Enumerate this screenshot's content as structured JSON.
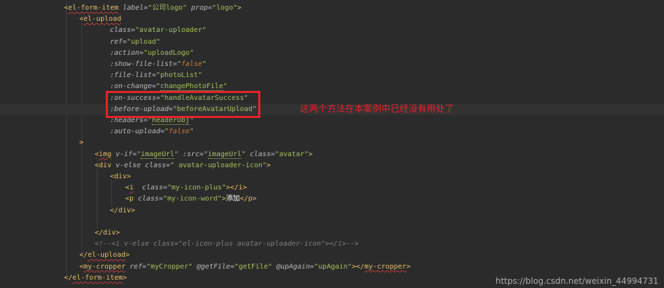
{
  "editor": {
    "lines": [
      {
        "id": "l0",
        "tokens": [
          {
            "c": "br",
            "t": "<"
          },
          {
            "c": "tag ut",
            "t": "el-form-item"
          },
          {
            "c": "eq",
            "t": " "
          },
          {
            "c": "attr",
            "t": "label"
          },
          {
            "c": "eq",
            "t": "="
          },
          {
            "c": "val",
            "t": "\"公司logo\""
          },
          {
            "c": "eq",
            "t": " "
          },
          {
            "c": "attr",
            "t": "prop"
          },
          {
            "c": "eq",
            "t": "="
          },
          {
            "c": "val",
            "t": "\"logo\""
          },
          {
            "c": "br",
            "t": ">"
          }
        ]
      },
      {
        "id": "l1",
        "tokens": [
          {
            "c": "br",
            "t": "<"
          },
          {
            "c": "tag ut",
            "t": "el-upload"
          }
        ]
      },
      {
        "id": "l2",
        "tokens": [
          {
            "c": "attr",
            "t": "class"
          },
          {
            "c": "eq",
            "t": "="
          },
          {
            "c": "val",
            "t": "\"avatar-uploader\""
          }
        ]
      },
      {
        "id": "l3",
        "tokens": [
          {
            "c": "attr",
            "t": "ref"
          },
          {
            "c": "eq",
            "t": "="
          },
          {
            "c": "val",
            "t": "\"upload\""
          }
        ]
      },
      {
        "id": "l4",
        "tokens": [
          {
            "c": "attr",
            "t": ":action"
          },
          {
            "c": "eq",
            "t": "="
          },
          {
            "c": "val",
            "t": "\"uploadLogo\""
          }
        ]
      },
      {
        "id": "l5",
        "tokens": [
          {
            "c": "attr",
            "t": ":show-file-list"
          },
          {
            "c": "eq",
            "t": "="
          },
          {
            "c": "val",
            "t": "\""
          },
          {
            "c": "kw",
            "t": "false"
          },
          {
            "c": "val",
            "t": "\""
          }
        ]
      },
      {
        "id": "l6",
        "tokens": [
          {
            "c": "attr",
            "t": ":file-list"
          },
          {
            "c": "eq",
            "t": "="
          },
          {
            "c": "val",
            "t": "\"photoList\""
          }
        ]
      },
      {
        "id": "l7",
        "tokens": [
          {
            "c": "attr",
            "t": ":on-change"
          },
          {
            "c": "eq",
            "t": "="
          },
          {
            "c": "val",
            "t": "\""
          },
          {
            "c": "val u",
            "t": "changePhotoFile"
          },
          {
            "c": "val",
            "t": "\""
          }
        ]
      },
      {
        "id": "l8",
        "tokens": [
          {
            "c": "attr",
            "t": ":on-success"
          },
          {
            "c": "eq",
            "t": "="
          },
          {
            "c": "val",
            "t": "\"handleAvatarSuccess\""
          }
        ]
      },
      {
        "id": "l9",
        "tokens": [
          {
            "c": "attr",
            "t": ":before-upload"
          },
          {
            "c": "eq",
            "t": "="
          },
          {
            "c": "val",
            "t": "\"beforeAvatarUpload\""
          }
        ]
      },
      {
        "id": "l10",
        "tokens": [
          {
            "c": "attr",
            "t": ":headers"
          },
          {
            "c": "eq",
            "t": "="
          },
          {
            "c": "val",
            "t": "\""
          },
          {
            "c": "val u",
            "t": "headerObj"
          },
          {
            "c": "val",
            "t": "\""
          }
        ]
      },
      {
        "id": "l11",
        "tokens": [
          {
            "c": "attr",
            "t": ":auto-upload"
          },
          {
            "c": "eq",
            "t": "="
          },
          {
            "c": "val",
            "t": "\""
          },
          {
            "c": "kw",
            "t": "false"
          },
          {
            "c": "val",
            "t": "\""
          }
        ]
      },
      {
        "id": "l12",
        "tokens": [
          {
            "c": "br",
            "t": ">"
          }
        ]
      },
      {
        "id": "l13",
        "tokens": [
          {
            "c": "br",
            "t": "<"
          },
          {
            "c": "tag ut",
            "t": "img"
          },
          {
            "c": "eq",
            "t": " "
          },
          {
            "c": "attr",
            "t": "v-if"
          },
          {
            "c": "eq",
            "t": "="
          },
          {
            "c": "val",
            "t": "\""
          },
          {
            "c": "val u",
            "t": "imageUrl"
          },
          {
            "c": "val",
            "t": "\""
          },
          {
            "c": "eq",
            "t": " "
          },
          {
            "c": "attr",
            "t": ":src"
          },
          {
            "c": "eq",
            "t": "="
          },
          {
            "c": "val",
            "t": "\""
          },
          {
            "c": "val u",
            "t": "imageUrl"
          },
          {
            "c": "val",
            "t": "\""
          },
          {
            "c": "eq",
            "t": " "
          },
          {
            "c": "attr",
            "t": "class"
          },
          {
            "c": "eq",
            "t": "="
          },
          {
            "c": "val",
            "t": "\"avatar\""
          },
          {
            "c": "br",
            "t": ">"
          }
        ]
      },
      {
        "id": "l14",
        "tokens": [
          {
            "c": "br",
            "t": "<"
          },
          {
            "c": "tag",
            "t": "div"
          },
          {
            "c": "eq",
            "t": " "
          },
          {
            "c": "attr",
            "t": "v-else"
          },
          {
            "c": "eq",
            "t": " "
          },
          {
            "c": "attr",
            "t": "class"
          },
          {
            "c": "eq",
            "t": "="
          },
          {
            "c": "val",
            "t": "\" avatar-uploader-icon\""
          },
          {
            "c": "br",
            "t": ">"
          }
        ]
      },
      {
        "id": "l15",
        "tokens": [
          {
            "c": "br",
            "t": "<"
          },
          {
            "c": "tag",
            "t": "div"
          },
          {
            "c": "br",
            "t": ">"
          }
        ]
      },
      {
        "id": "l16",
        "tokens": [
          {
            "c": "br",
            "t": "<"
          },
          {
            "c": "tag ut",
            "t": "i"
          },
          {
            "c": "eq",
            "t": "  "
          },
          {
            "c": "attr",
            "t": "class"
          },
          {
            "c": "eq",
            "t": "="
          },
          {
            "c": "val",
            "t": "\"my-icon-plus\""
          },
          {
            "c": "br",
            "t": "></"
          },
          {
            "c": "tag",
            "t": "i"
          },
          {
            "c": "br",
            "t": ">"
          }
        ]
      },
      {
        "id": "l17",
        "tokens": [
          {
            "c": "br",
            "t": "<"
          },
          {
            "c": "tag",
            "t": "p"
          },
          {
            "c": "eq",
            "t": " "
          },
          {
            "c": "attr",
            "t": "class"
          },
          {
            "c": "eq",
            "t": "="
          },
          {
            "c": "val",
            "t": "\"my-icon-word\""
          },
          {
            "c": "br",
            "t": ">"
          },
          {
            "c": "txt",
            "t": "添加"
          },
          {
            "c": "br",
            "t": "</"
          },
          {
            "c": "tag",
            "t": "p"
          },
          {
            "c": "br",
            "t": ">"
          }
        ]
      },
      {
        "id": "l18",
        "tokens": [
          {
            "c": "br",
            "t": "</"
          },
          {
            "c": "tag",
            "t": "div"
          },
          {
            "c": "br",
            "t": ">"
          }
        ]
      },
      {
        "id": "l19",
        "tokens": []
      },
      {
        "id": "l20",
        "tokens": [
          {
            "c": "br",
            "t": "</"
          },
          {
            "c": "tag",
            "t": "div"
          },
          {
            "c": "br",
            "t": ">"
          }
        ]
      },
      {
        "id": "l21",
        "tokens": [
          {
            "c": "cmt2",
            "t": "<!--<i v-else class=\"el-icon-plus avatar-uploader-icon\"></i>-->"
          }
        ]
      },
      {
        "id": "l22",
        "tokens": [
          {
            "c": "br",
            "t": "</"
          },
          {
            "c": "tag ut",
            "t": "el-upload"
          },
          {
            "c": "br",
            "t": ">"
          }
        ]
      },
      {
        "id": "l23",
        "tokens": [
          {
            "c": "br",
            "t": "<"
          },
          {
            "c": "tag ut",
            "t": "my-cropper"
          },
          {
            "c": "eq",
            "t": " "
          },
          {
            "c": "attr",
            "t": "ref"
          },
          {
            "c": "eq",
            "t": "="
          },
          {
            "c": "val",
            "t": "\"myCropper\""
          },
          {
            "c": "eq",
            "t": " "
          },
          {
            "c": "attr",
            "t": "@getFile"
          },
          {
            "c": "eq",
            "t": "="
          },
          {
            "c": "val",
            "t": "\"getFile\""
          },
          {
            "c": "eq",
            "t": " "
          },
          {
            "c": "attr",
            "t": "@upAgain"
          },
          {
            "c": "eq",
            "t": "="
          },
          {
            "c": "val",
            "t": "\"upAgain\""
          },
          {
            "c": "br",
            "t": "></"
          },
          {
            "c": "tag ut",
            "t": "my-cropper"
          },
          {
            "c": "br",
            "t": ">"
          }
        ]
      },
      {
        "id": "l24",
        "tokens": [
          {
            "c": "br",
            "t": "</"
          },
          {
            "c": "tag ut",
            "t": "el-form-item"
          },
          {
            "c": "br",
            "t": ">"
          }
        ]
      }
    ]
  },
  "annotation": {
    "note": "这两个方法在本案例中已经没有用处了"
  },
  "watermark": {
    "text": "https://blog.csdn.net/weixin_44994731"
  },
  "colors": {
    "background": "#2b2b2b",
    "highlight_box": "#e8232a",
    "tag": "#e8bf6a",
    "attribute": "#bababa",
    "string": "#a5c261",
    "keyword": "#cc7832"
  }
}
